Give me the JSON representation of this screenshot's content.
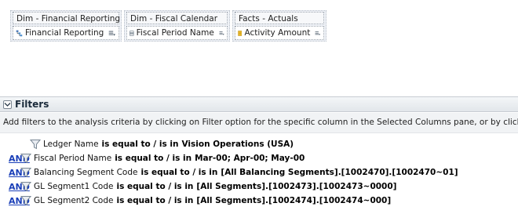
{
  "selected_columns": [
    {
      "group": "Dim - Financial Reporting",
      "column": "Financial Reporting",
      "icon": "hierarchy-icon"
    },
    {
      "group": "Dim - Fiscal Calendar",
      "column": "Fiscal Period Name",
      "icon": "attribute-column-icon"
    },
    {
      "group": "Facts - Actuals",
      "column": "Activity Amount",
      "icon": "measure-column-icon"
    }
  ],
  "filters_section": {
    "title": "Filters",
    "instructions": "Add filters to the analysis criteria by clicking on Filter option for the specific column in the Selected Columns pane, or by clicking on the f",
    "and_label": "AND",
    "operator": "is equal to / is in",
    "items": [
      {
        "column": "Ledger Name",
        "value": "Vision Operations (USA)"
      },
      {
        "column": "Fiscal Period Name",
        "value": "Mar-00; Apr-00; May-00"
      },
      {
        "column": "Balancing Segment Code",
        "value": "[All Balancing Segments].[1002470].[1002470~01]"
      },
      {
        "column": "GL Segment1 Code",
        "value": "[All Segments].[1002473].[1002473~0000]"
      },
      {
        "column": "GL Segment2 Code",
        "value": "[All Segments].[1002474].[1002474~000]"
      }
    ]
  },
  "colors": {
    "link": "#1a3fb8",
    "panel_bg": "#eef1f6",
    "header_bg": "#e2e6ea"
  }
}
